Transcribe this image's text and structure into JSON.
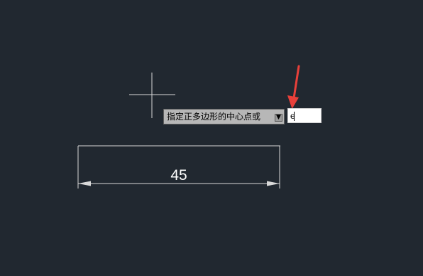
{
  "colors": {
    "background": "#212830",
    "geometry": "#d9d9d9",
    "arrow": "#e8403a",
    "prompt_bg": "#b7b7b7",
    "input_bg": "#ffffff"
  },
  "cursor": {
    "icon": "crosshair-cursor-icon"
  },
  "dimension": {
    "value": "45"
  },
  "dynamic_input": {
    "prompt": "指定正多边形的中心点或",
    "dropdown_icon": "down-arrow-icon",
    "value": "e"
  },
  "annotation": {
    "icon": "red-pointer-arrow-icon"
  }
}
